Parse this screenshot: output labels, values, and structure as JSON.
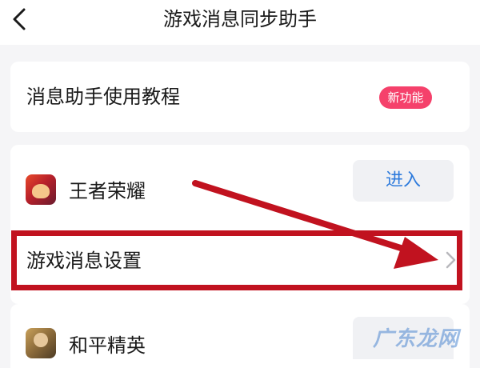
{
  "header": {
    "title": "游戏消息同步助手",
    "back_icon": "chevron-left-icon"
  },
  "tutorial": {
    "label": "消息助手使用教程",
    "badge": "新功能",
    "badge_color": "#f5416b"
  },
  "games": [
    {
      "name": "王者荣耀",
      "action_label": "进入",
      "icon": "honor-of-kings-icon"
    },
    {
      "name": "和平精英",
      "icon": "peacekeeper-elite-icon"
    }
  ],
  "settings_row": {
    "label": "游戏消息设置",
    "chevron_icon": "chevron-right-icon"
  },
  "annotation": {
    "highlight_color": "#c1121f"
  },
  "watermark": {
    "text": "广东龙网"
  },
  "colors": {
    "accent": "#2e7bdc",
    "background": "#f5f5f7"
  }
}
